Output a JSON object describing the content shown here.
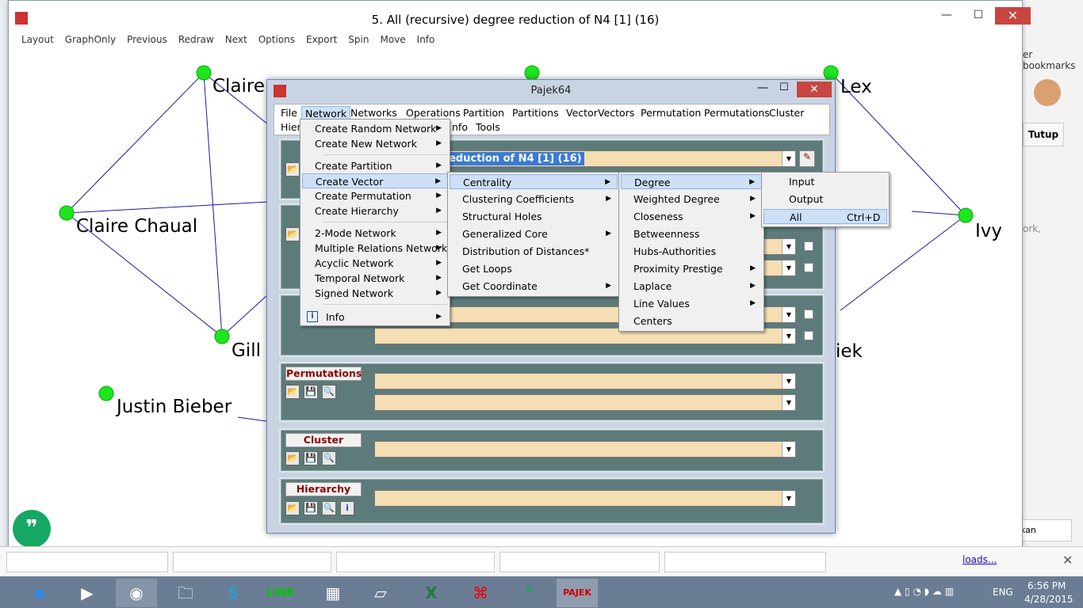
{
  "drawwin": {
    "title": "5. All (recursive) degree reduction of N4 [1] (16)",
    "menu": [
      "Layout",
      "GraphOnly",
      "Previous",
      "Redraw",
      "Next",
      "Options",
      "Export",
      "Spin",
      "Move",
      "Info"
    ],
    "minimize": "—",
    "maximize": "☐",
    "close": "✕"
  },
  "graph": {
    "nodes": [
      "Claire",
      "Claire Chaual",
      "Gill",
      "Justin Bieber",
      "Lex",
      "Ivy",
      "iek"
    ]
  },
  "chrome": {
    "bookmarks": "er bookmarks",
    "tutup": "Tutup",
    "ork": "ork,",
    "keluhan": "kan keluhan",
    "downloads": "loads..."
  },
  "pajek": {
    "title": "Pajek64",
    "menubar": [
      "File",
      "Network",
      "Networks",
      "Operations",
      "Partition",
      "Partitions",
      "Vector",
      "Vectors",
      "Permutation",
      "Permutations",
      "Cluster"
    ],
    "menubar2": [
      "Hiera",
      "nfo",
      "Tools"
    ],
    "network_combo": "re) degree reduction of N4 [1] (16)",
    "panels": [
      "Permutations",
      "Cluster",
      "Hierarchy"
    ]
  },
  "menu_network": {
    "items": [
      "Create Random Network",
      "Create New Network",
      "Create Partition",
      "Create Vector",
      "Create Permutation",
      "Create Hierarchy",
      "2-Mode Network",
      "Multiple Relations Network",
      "Acyclic Network",
      "Temporal Network",
      "Signed Network",
      "Info"
    ]
  },
  "menu_vector": {
    "items": [
      "Centrality",
      "Clustering Coefficients",
      "Structural Holes",
      "Generalized Core",
      "Distribution of Distances*",
      "Get Loops",
      "Get Coordinate"
    ]
  },
  "menu_centrality": {
    "items": [
      "Degree",
      "Weighted Degree",
      "Closeness",
      "Betweenness",
      "Hubs-Authorities",
      "Proximity Prestige",
      "Laplace",
      "Line Values",
      "Centers"
    ]
  },
  "menu_degree": {
    "items": [
      "Input",
      "Output",
      "All"
    ],
    "shortcut": "Ctrl+D"
  },
  "taskbar": {
    "lang": "ENG",
    "time": "6:56 PM",
    "date": "4/28/2015"
  }
}
